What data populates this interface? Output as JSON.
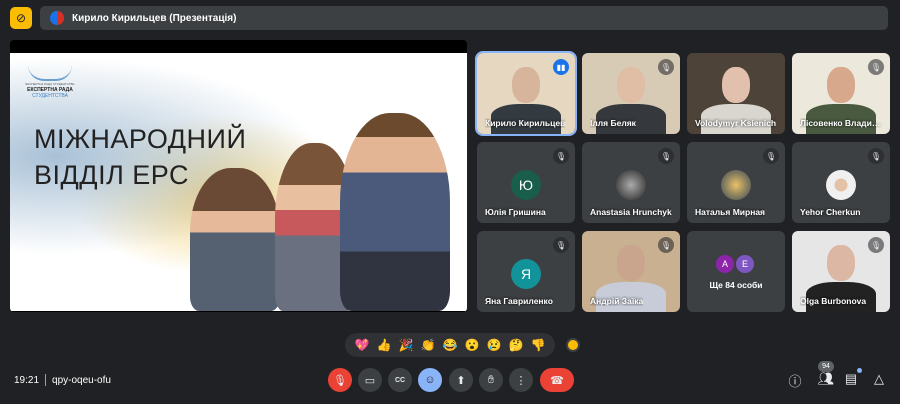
{
  "top_bar": {
    "hide_icon": "presentation-off-icon",
    "presenter_label": "Кирило Кирильцев (Презентація)"
  },
  "slide": {
    "logo_small": "ЕКСПЕРТНА РАДА СТУДЕНТСТВА",
    "logo_line1": "ЕКСПЕРТНА РАДА",
    "logo_line2": "СТУДЕНТСТВА",
    "title_line1": "МІЖНАРОДНИЙ",
    "title_line2": "ВІДДІЛ ЕРС"
  },
  "participants": [
    {
      "name": "Кирило Кирильцев",
      "speaking": true
    },
    {
      "name": "Ілля Беляк",
      "muted": true
    },
    {
      "name": "Volodymyr Ksienich"
    },
    {
      "name": "Лісовенко Владислав",
      "muted": true
    },
    {
      "name": "Юлія Гришина",
      "initial": "Ю",
      "color": "#185e4a",
      "muted": true
    },
    {
      "name": "Anastasia Hrunchyk",
      "muted": true
    },
    {
      "name": "Наталья Мирная",
      "muted": true
    },
    {
      "name": "Yehor Cherkun",
      "muted": true
    },
    {
      "name": "Яна Гавриленко",
      "initial": "Я",
      "color": "#12939a",
      "muted": true
    },
    {
      "name": "Андрій Заїка",
      "muted": true
    },
    {
      "others_label": "Ще 84 особи",
      "initials": [
        "А",
        "Е"
      ],
      "colors": [
        "#8e24aa",
        "#7e57c2"
      ]
    },
    {
      "name": "Olga Burbonova",
      "muted": true
    }
  ],
  "reactions": [
    "💖",
    "👍",
    "🎉",
    "👏",
    "😂",
    "😮",
    "😢",
    "🤔",
    "👎"
  ],
  "meeting": {
    "time": "19:21",
    "code": "qpy-oqeu-ofu"
  },
  "controls": {
    "people_count": "94",
    "mic_color": "#ea4335",
    "accent": "#8ab4f8"
  }
}
